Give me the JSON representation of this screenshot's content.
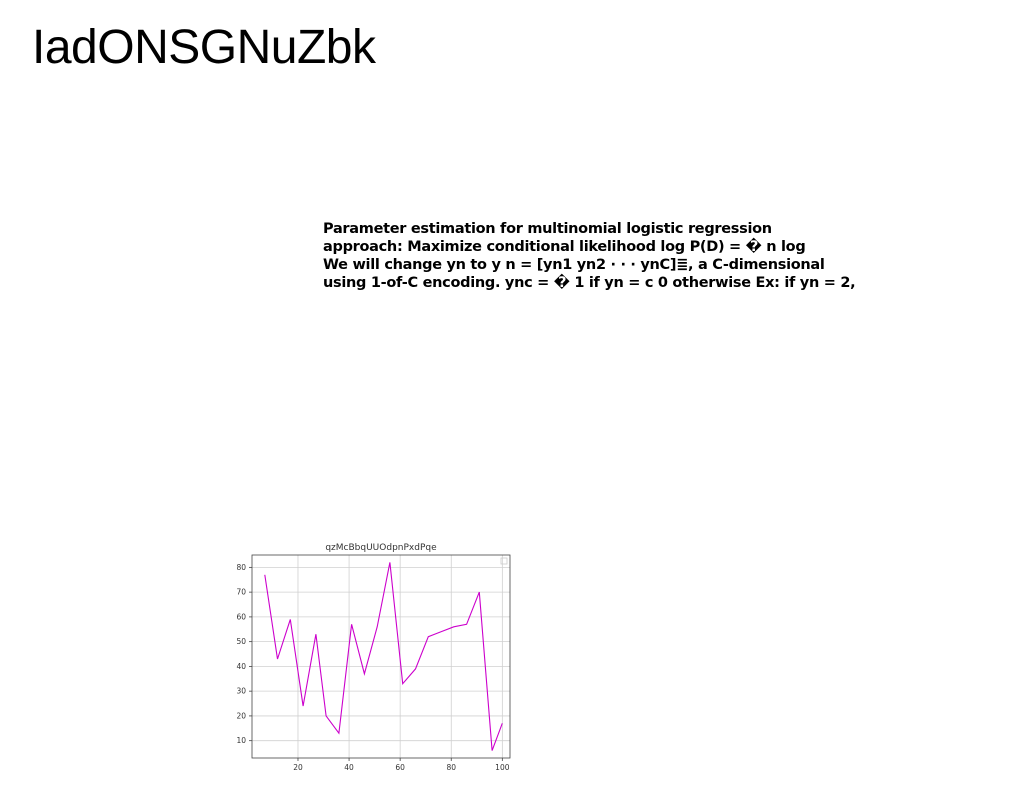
{
  "page": {
    "title": "IadONSGNuZbk"
  },
  "text_block": {
    "lines": [
      "Parameter estimation for multinomial logistic regression",
      "approach: Maximize conditional likelihood log P(D) = � n log",
      "We will change yn to y n = [yn1 yn2 · · · ynC]≣, a C-dimensional",
      "using 1-of-C encoding. ync = � 1 if yn = c 0 otherwise Ex: if yn = 2,"
    ]
  },
  "chart_data": {
    "type": "line",
    "title": "qzMcBbqUUOdpnPxdPqe",
    "xlabel": "",
    "ylabel": "",
    "xlim": [
      2,
      103
    ],
    "ylim": [
      3,
      85
    ],
    "xticks": [
      20,
      40,
      60,
      80,
      100
    ],
    "yticks": [
      10,
      20,
      30,
      40,
      50,
      60,
      70,
      80
    ],
    "grid": true,
    "legend": "top-right (empty box)",
    "series": [
      {
        "color": "#cc00cc",
        "x": [
          7,
          12,
          17,
          22,
          27,
          31,
          36,
          41,
          46,
          51,
          56,
          61,
          66,
          71,
          76,
          81,
          86,
          91,
          96,
          100
        ],
        "y": [
          77,
          43,
          59,
          24,
          53,
          20,
          13,
          57,
          37,
          56,
          82,
          33,
          39,
          52,
          54,
          56,
          57,
          70,
          6,
          17
        ]
      }
    ]
  }
}
